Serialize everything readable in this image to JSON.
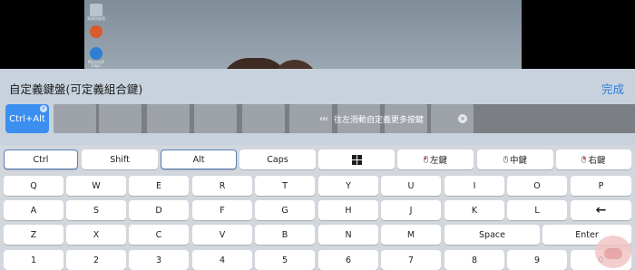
{
  "desktop": {
    "icons": [
      {
        "name": "recycle-bin-icon",
        "label": "資源回收筒",
        "color": "#b9c3cc"
      },
      {
        "name": "app-shortcut-icon",
        "label": "",
        "color": "#d95b2b"
      },
      {
        "name": "edge-icon",
        "label": "Microsoft Edge",
        "color": "#2f7fd4"
      }
    ]
  },
  "custom_bar": {
    "title": "自定義鍵盤(可定義組合鍵)",
    "done_label": "完成",
    "combo_key": "Ctrl+Alt",
    "remove_symbol": "×",
    "hint": "往左滑動自定義更多按鍵",
    "hint_chevrons": "‹‹‹",
    "clear_symbol": "×"
  },
  "keyboard": {
    "modifier_row": [
      "Ctrl",
      "Shift",
      "Alt",
      "Caps",
      "",
      "左鍵",
      "中鍵",
      "右鍵"
    ],
    "row1": [
      "Q",
      "W",
      "E",
      "R",
      "T",
      "Y",
      "U",
      "I",
      "O",
      "P"
    ],
    "row2": [
      "A",
      "S",
      "D",
      "F",
      "G",
      "H",
      "J",
      "K",
      "L",
      "←"
    ],
    "row3": [
      "Z",
      "X",
      "C",
      "V",
      "B",
      "N",
      "M",
      "Space",
      "Enter"
    ],
    "row4": [
      "1",
      "2",
      "3",
      "4",
      "5",
      "6",
      "7",
      "8",
      "9",
      "0"
    ]
  },
  "colors": {
    "accent": "#3a8ff0",
    "done": "#2b7de1",
    "selected_border": "#5a7fb8"
  }
}
